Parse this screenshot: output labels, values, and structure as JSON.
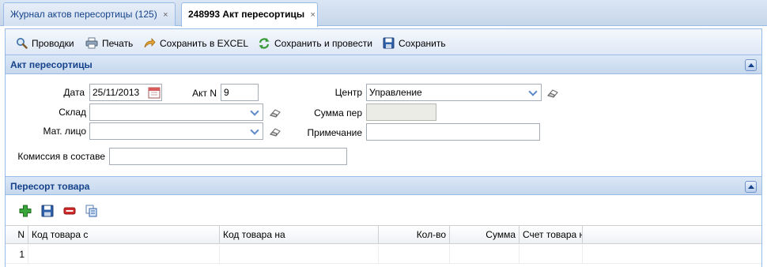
{
  "tabs": [
    {
      "label": "Журнал актов пересортицы (125)",
      "close": "×"
    },
    {
      "label": "248993 Акт пересортицы",
      "close": "×"
    }
  ],
  "toolbar": {
    "postings": "Проводки",
    "print": "Печать",
    "save_excel": "Сохранить в EXCEL",
    "save_post": "Сохранить и провести",
    "save": "Сохранить"
  },
  "act_section": {
    "title": "Акт пересортицы",
    "date_label": "Дата",
    "date_value": "25/11/2013",
    "act_no_label": "Акт N",
    "act_no_value": "9",
    "center_label": "Центр",
    "center_value": "Управление",
    "warehouse_label": "Склад",
    "warehouse_value": "",
    "sum_label": "Сумма пер",
    "sum_value": "",
    "person_label": "Мат. лицо",
    "person_value": "",
    "note_label": "Примечание",
    "note_value": "",
    "commission_label": "Комиссия в составе",
    "commission_value": ""
  },
  "goods_section": {
    "title": "Пересорт товара",
    "columns": [
      "N",
      "Код товара с",
      "Код товара на",
      "Кол-во",
      "Сумма",
      "Счет товара н"
    ],
    "rows": [
      {
        "n": "1",
        "code_from": "",
        "code_to": "",
        "qty": "",
        "sum": "",
        "account": ""
      }
    ]
  },
  "icons": {
    "postings": "magnifier-icon",
    "print": "printer-icon",
    "save_excel": "export-arrow-icon",
    "save_post": "refresh-green-icon",
    "save": "floppy-disk-icon",
    "add": "add-plus-icon",
    "grid_save": "floppy-disk-icon",
    "delete": "delete-minus-icon",
    "copy": "copy-icon"
  },
  "colors": {
    "header_text": "#15428b",
    "border": "#99bbe8",
    "add_green": "#3aa53a",
    "delete_red": "#d22b2b"
  }
}
